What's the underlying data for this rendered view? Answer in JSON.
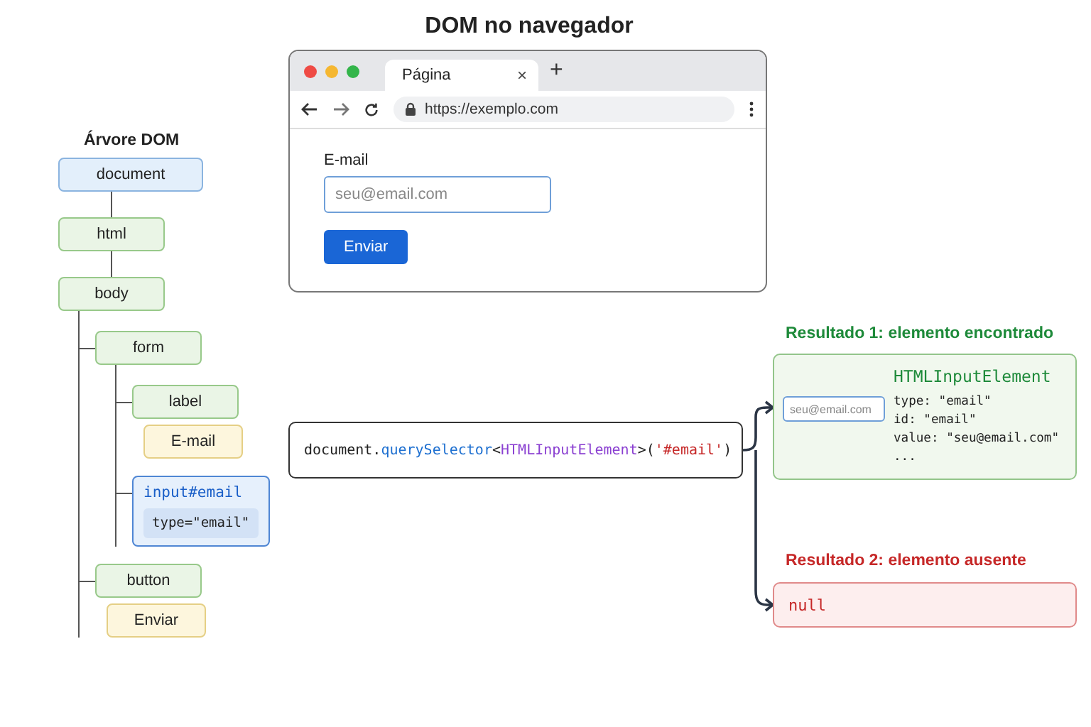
{
  "title": "DOM no navegador",
  "browser": {
    "tab_title": "Página",
    "tab_close": "×",
    "new_tab": "+",
    "url": "https://exemplo.com",
    "form": {
      "label": "E-mail",
      "placeholder": "seu@email.com",
      "button": "Enviar"
    }
  },
  "tree": {
    "title": "Árvore DOM",
    "root": {
      "label": "document",
      "kind": "root",
      "children": [
        {
          "label": "html",
          "kind": "element",
          "children": [
            {
              "label": "body",
              "kind": "element",
              "children": [
                {
                  "label": "form",
                  "kind": "element",
                  "children": [
                    {
                      "label": "label",
                      "kind": "element",
                      "children": [
                        {
                          "label": "E-mail",
                          "kind": "text"
                        }
                      ]
                    },
                    {
                      "label": "input#email",
                      "kind": "highlight",
                      "attribute": "type=\"email\""
                    }
                  ]
                },
                {
                  "label": "button",
                  "kind": "element",
                  "children": [
                    {
                      "label": "Enviar",
                      "kind": "text"
                    }
                  ]
                }
              ]
            }
          ]
        }
      ]
    }
  },
  "query": {
    "parts": [
      {
        "text": "document",
        "kind": "plain"
      },
      {
        "text": ".",
        "kind": "plain"
      },
      {
        "text": "querySelector",
        "kind": "method"
      },
      {
        "text": "<",
        "kind": "plain"
      },
      {
        "text": "HTMLInputElement",
        "kind": "type"
      },
      {
        "text": ">(",
        "kind": "plain"
      },
      {
        "text": "'#email'",
        "kind": "string"
      },
      {
        "text": ")",
        "kind": "plain"
      }
    ]
  },
  "results": [
    {
      "kind": "found",
      "title": "Resultado 1: elemento encontrado",
      "type_name": "HTMLInputElement",
      "placeholder": "seu@email.com",
      "lines": [
        "type: \"email\"",
        "id: \"email\"",
        "value: \"seu@email.com\"",
        "..."
      ]
    },
    {
      "kind": "absent",
      "title": "Resultado 2: elemento ausente",
      "value": "null"
    }
  ]
}
